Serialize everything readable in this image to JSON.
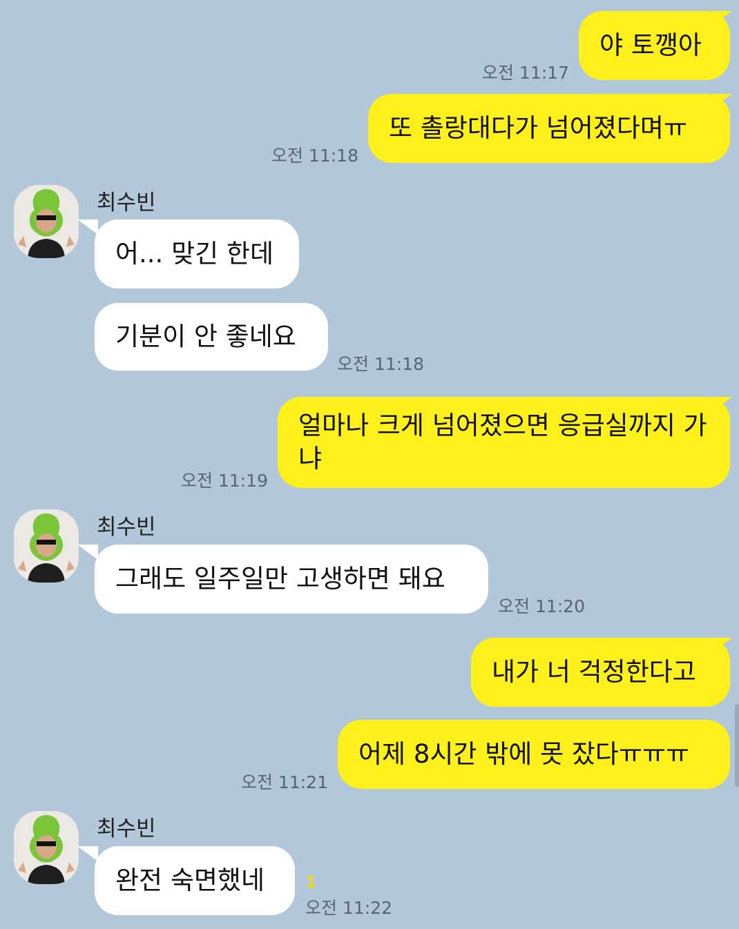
{
  "contact": {
    "name": "최수빈"
  },
  "messages": [
    {
      "from": "me",
      "text": "야 토깽아",
      "time": "오전 11:17"
    },
    {
      "from": "me",
      "text": "또 촐랑대다가 넘어졌다며ㅠ",
      "time": "오전 11:18"
    },
    {
      "from": "them",
      "text": "어... 맞긴 한데"
    },
    {
      "from": "them",
      "text": "기분이 안 좋네요",
      "time": "오전 11:18"
    },
    {
      "from": "me",
      "text": "얼마나 크게 넘어졌으면 응급실까지 가냐",
      "time": "오전 11:19"
    },
    {
      "from": "them",
      "text": "그래도 일주일만 고생하면 돼요",
      "time": "오전 11:20"
    },
    {
      "from": "me",
      "text": "내가 너 걱정한다고"
    },
    {
      "from": "me",
      "text": "어제 8시간 밖에 못 잤다ㅠㅠㅠ",
      "time": "오전 11:21"
    },
    {
      "from": "them",
      "text": "완전 숙면했네",
      "time": "오전 11:22",
      "unread": "1"
    }
  ],
  "colors": {
    "background": "#b2c7da",
    "my_bubble": "#fef01b",
    "their_bubble": "#ffffff"
  }
}
